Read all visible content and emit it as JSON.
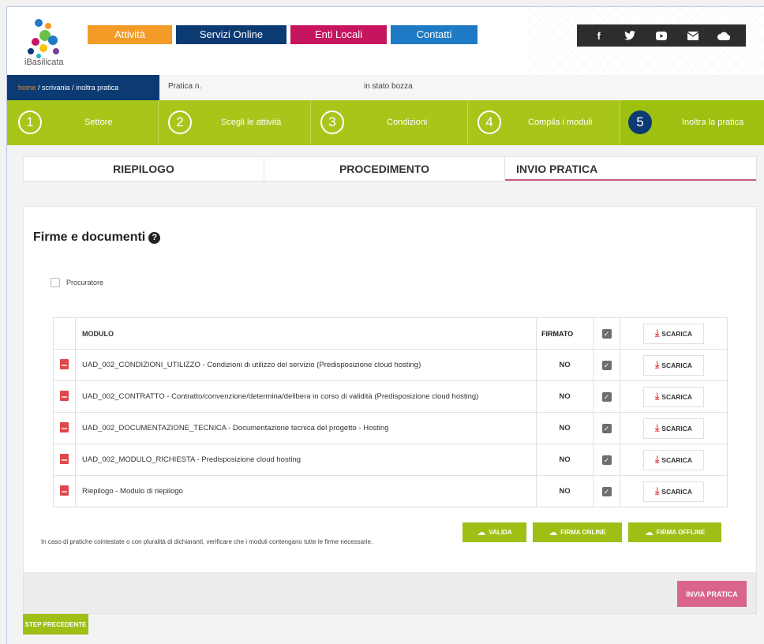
{
  "header": {
    "logo_text": "iBasilicata",
    "nav": [
      {
        "label": "Attività",
        "color": "#f39b26"
      },
      {
        "label": "Servizi Online",
        "color": "#0c3a73"
      },
      {
        "label": "Enti Locali",
        "color": "#c6155e"
      },
      {
        "label": "Contatti",
        "color": "#1f7ac5"
      }
    ],
    "social": [
      "f",
      "t",
      "yt",
      "mail",
      "cloud"
    ]
  },
  "breadcrumb": {
    "home": "home",
    "scrivania": "scrivania",
    "current": "inoltra pratica",
    "pratica_label": "Pratica n.",
    "stato_label": "in stato bozza"
  },
  "steps": [
    {
      "num": "1",
      "label": "Settore"
    },
    {
      "num": "2",
      "label": "Scegli le attività"
    },
    {
      "num": "3",
      "label": "Condizioni"
    },
    {
      "num": "4",
      "label": "Compila i moduli"
    },
    {
      "num": "5",
      "label": "Inoltra la pratica"
    }
  ],
  "tabs": [
    "RIEPILOGO",
    "PROCEDIMENTO",
    "INVIO PRATICA"
  ],
  "panel": {
    "title": "Firme e documenti",
    "procuratore_label": "Procuratore",
    "table": {
      "headers": {
        "modulo": "MODULO",
        "firmato": "FIRMATO",
        "scarica": "SCARICA"
      },
      "rows": [
        {
          "modulo": "UAD_002_CONDIZIONI_UTILIZZO - Condizioni di utilizzo del servizio (Predisposizione cloud hosting)",
          "firmato": "NO"
        },
        {
          "modulo": "UAD_002_CONTRATTO - Contratto/convenzione/determina/delibera in corso di validità (Predisposizione cloud hosting)",
          "firmato": "NO"
        },
        {
          "modulo": "UAD_002_DOCUMENTAZIONE_TECNICA - Documentazione tecnica del progetto - Hosting",
          "firmato": "NO"
        },
        {
          "modulo": "UAD_002_MODULO_RICHIESTA - Predisposizione cloud hosting",
          "firmato": "NO"
        },
        {
          "modulo": "Riepilogo - Modulo di riepilogo",
          "firmato": "NO"
        }
      ],
      "scarica_label": "SCARICA"
    },
    "note": "In caso di pratiche cointestate o con pluralità di dichiaranti, verificare che i moduli contengano tutte le firme necessarie.",
    "buttons": {
      "valida": "VALIDA",
      "firma_online": "FIRMA ONLINE",
      "firma_offline": "FIRMA OFFLINE"
    }
  },
  "footer": {
    "invia": "INVIA PRATICA",
    "prev": "STEP PRECEDENTE"
  }
}
